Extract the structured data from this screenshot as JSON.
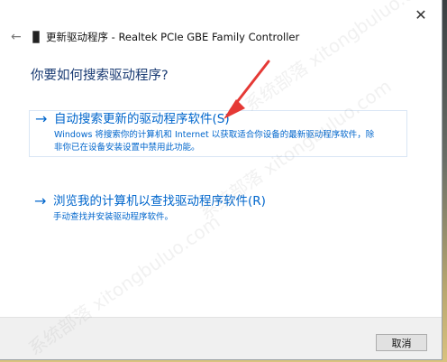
{
  "window": {
    "title": "更新驱动程序 - Realtek PCIe GBE Family Controller",
    "close_icon": "close-icon",
    "back_icon": "back-arrow-icon",
    "device_icon": "network-adapter-icon"
  },
  "main": {
    "heading": "你要如何搜索驱动程序?",
    "options": [
      {
        "icon": "right-arrow-icon",
        "title": "自动搜索更新的驱动程序软件(S)",
        "description": "Windows 将搜索你的计算机和 Internet 以获取适合你设备的最新驱动程序软件，除非你已在设备安装设置中禁用此功能。"
      },
      {
        "icon": "right-arrow-icon",
        "title": "浏览我的计算机以查找驱动程序软件(R)",
        "description": "手动查找并安装驱动程序软件。"
      }
    ]
  },
  "footer": {
    "cancel_label": "取消"
  },
  "colors": {
    "accent": "#0066cc",
    "heading": "#1a3b73",
    "annotation_arrow": "#e53935"
  },
  "watermark": {
    "text": "系统部落 xitongbuluo.com"
  }
}
